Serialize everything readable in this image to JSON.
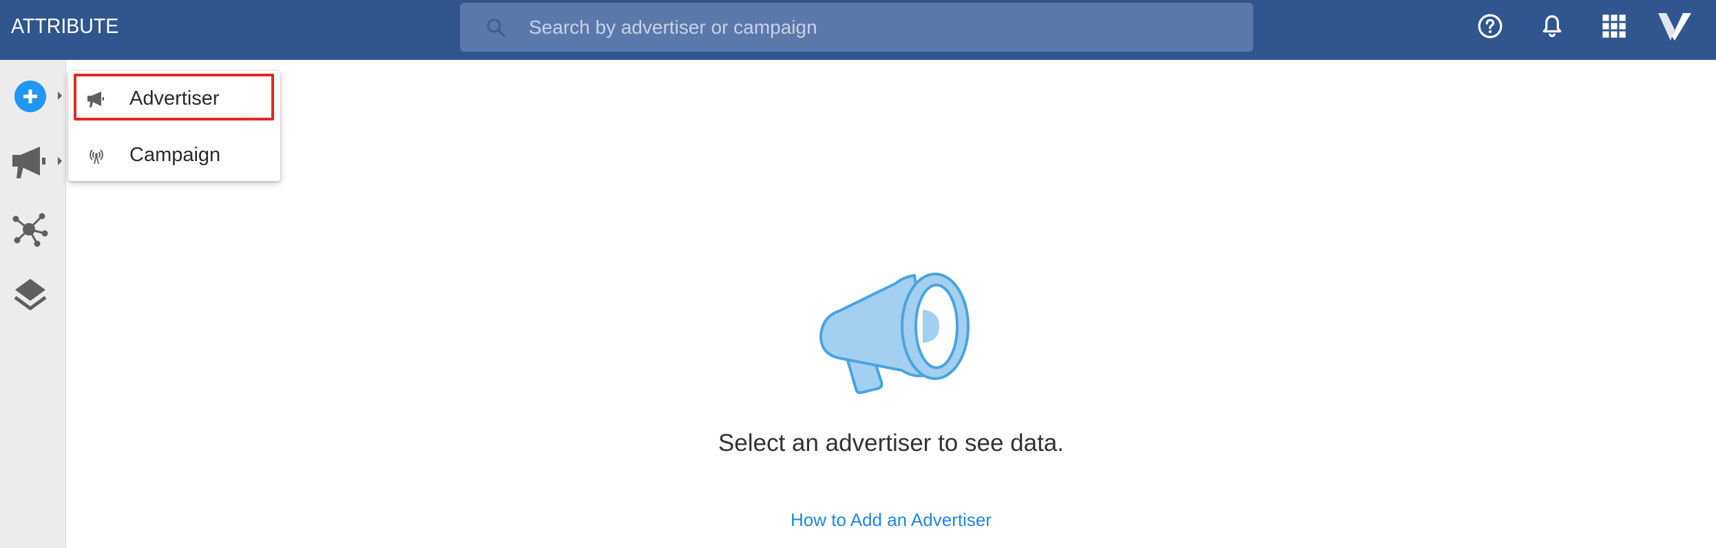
{
  "app": {
    "brand": "ATTRIBUTE",
    "colors": {
      "topbar": "#30558f",
      "accent": "#2196f3",
      "highlight": "#e02a1f",
      "link": "#1e88e5"
    }
  },
  "search": {
    "placeholder": "Search by advertiser or campaign",
    "icon": "search-icon"
  },
  "topbar_icons": [
    "help-icon",
    "bell-icon",
    "apps-grid-icon",
    "logo-v-icon"
  ],
  "sidebar": {
    "items": [
      {
        "name": "add",
        "icon": "plus-circle-icon",
        "has_submenu": true
      },
      {
        "name": "advertisers",
        "icon": "megaphone-icon",
        "has_submenu": true
      },
      {
        "name": "network",
        "icon": "network-icon",
        "has_submenu": false
      },
      {
        "name": "layers",
        "icon": "layers-icon",
        "has_submenu": false
      }
    ]
  },
  "add_menu": {
    "items": [
      {
        "label": "Advertiser",
        "icon": "megaphone-icon",
        "highlighted": true
      },
      {
        "label": "Campaign",
        "icon": "broadcast-icon",
        "highlighted": false
      }
    ]
  },
  "empty_state": {
    "illustration": "megaphone-illustration",
    "message": "Select an advertiser to see data.",
    "link_label": "How to Add an Advertiser"
  }
}
